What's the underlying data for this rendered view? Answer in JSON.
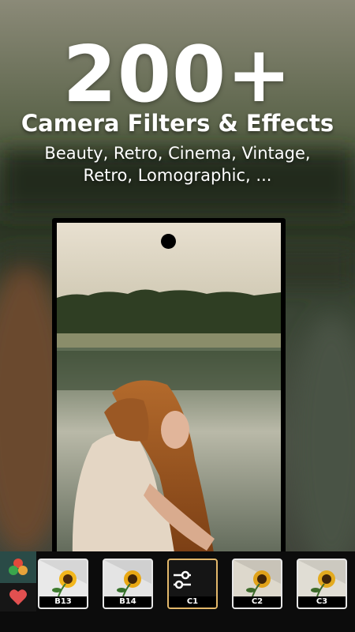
{
  "promo": {
    "headline": "200+",
    "subheadline": "Camera Filters & Effects",
    "description_line1": "Beauty, Retro, Cinema, Vintage,",
    "description_line2": "Retro, Lomographic, ..."
  },
  "side_panel": {
    "top_icon": "color-circles-icon",
    "bottom_icon": "heart-icon"
  },
  "filters": [
    {
      "label": "B13",
      "selected": false
    },
    {
      "label": "B14",
      "selected": false
    },
    {
      "label": "C1",
      "selected": true,
      "icon": "sliders-icon"
    },
    {
      "label": "C2",
      "selected": false
    },
    {
      "label": "C3",
      "selected": false
    }
  ],
  "colors": {
    "selected_border": "#e3b86b",
    "bar_bg": "#0c0c0c",
    "mood_bg": "#2a4b47"
  }
}
